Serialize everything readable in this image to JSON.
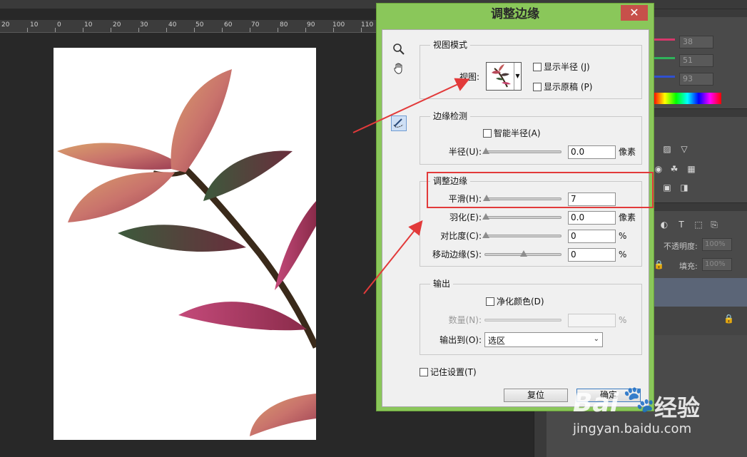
{
  "ruler": {
    "ticks": [
      "20",
      "10",
      "0",
      "10",
      "20",
      "30",
      "40",
      "50",
      "60",
      "70",
      "80",
      "90",
      "100",
      "110"
    ]
  },
  "panels": {
    "color_values": [
      "38",
      "51",
      "93"
    ],
    "opacity_label": "不透明度:",
    "opacity_value": "100%",
    "fill_label": "填充:",
    "fill_value": "100%"
  },
  "dialog": {
    "title": "调整边缘",
    "close_glyph": "✕",
    "view_mode": {
      "title": "视图模式",
      "view_label": "视图:",
      "show_radius": "显示半径 (J)",
      "show_original": "显示原稿 (P)"
    },
    "edge_detection": {
      "title": "边缘检测",
      "smart_radius": "智能半径(A)",
      "radius_label": "半径(U):",
      "radius_value": "0.0",
      "radius_unit": "像素"
    },
    "adjust_edge": {
      "title": "调整边缘",
      "smooth_label": "平滑(H):",
      "smooth_value": "7",
      "feather_label": "羽化(E):",
      "feather_value": "0.0",
      "feather_unit": "像素",
      "contrast_label": "对比度(C):",
      "contrast_value": "0",
      "contrast_unit": "%",
      "shift_label": "移动边缘(S):",
      "shift_value": "0",
      "shift_unit": "%"
    },
    "output": {
      "title": "输出",
      "decontaminate": "净化颜色(D)",
      "amount_label": "数量(N):",
      "amount_unit": "%",
      "output_to_label": "输出到(O):",
      "output_to_value": "选区"
    },
    "remember": "记住设置(T)",
    "reset_button": "复位",
    "ok_button": "确定"
  },
  "watermark": {
    "brand": "Bai",
    "brand2": "经验",
    "url": "jingyan.baidu.com"
  },
  "colors": {
    "dialog_frame": "#8ac75a",
    "annotation_red": "#e23a3a",
    "ps_dark": "#282828"
  }
}
